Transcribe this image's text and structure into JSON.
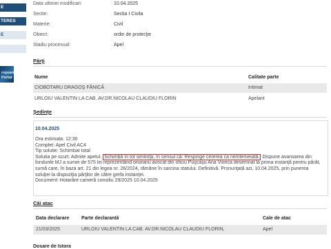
{
  "sidebar": {
    "items": [
      {
        "label": "E"
      },
      {
        "label": "TERES"
      },
      {
        "label": "E"
      },
      {
        "label": ""
      }
    ],
    "banner": {
      "line1": "ropean",
      "line2": "Portal"
    }
  },
  "case_info": [
    {
      "label": "Data ultimei modificari:",
      "value": "10.04.2025"
    },
    {
      "label": "Sectie:",
      "value": "Sectia I Civila"
    },
    {
      "label": "Materie:",
      "value": "Civil"
    },
    {
      "label": "Obiect:",
      "value": "ordin de protecţie"
    },
    {
      "label": "Stadiu procesual:",
      "value": "Apel"
    }
  ],
  "parti": {
    "title": "Părţi",
    "headers": {
      "name": "Nume",
      "role": "Calitate parte"
    },
    "rows": [
      {
        "name": "CIOBOTARU DRAGOŞ FĂNICĂ",
        "role": "Intimat"
      },
      {
        "name": "URLOIU VALENTIN LA CAB. AV.DR.NICOLAU CLAUDIU FLORIN",
        "role": "Apelant"
      }
    ]
  },
  "sedinte": {
    "title": "Şedinţe",
    "date": "10.04.2025",
    "ora": "Ora estimata: 12:30",
    "complet": "Complet: Apel Civil AC4",
    "tip": "Tip solutie: Schimbat total",
    "solutie_prefix": "Solutia pe scurt: Admite apelul.",
    "solutie_highlight": "Schimbă în tot sentinţa, în sensul că: Respinge cererea ca neîntemeiată.",
    "solutie_rest": "Dispune avansarea din fondurile MJ a sumei de 575 lei reprezentând onorariu avocat din oficiu Puşcaşu Ana Viorica desemnat la prima instanţă pentru pârât, sumă care, în baza art. 21 din legea nr. 26/2024, rămâne în sarcina statului. Definitivă. Pronunţată azi, 10.04.2025, prin punerea soluţiei la dispoziţia părţilor de către grefa instanţei.",
    "document": "Document: Hotarâre cameră consiliu  29/2025  10.04.2025"
  },
  "cai_atac": {
    "title": "Căi atac",
    "headers": {
      "date": "Data declarare",
      "party": "Parte declarantă",
      "type": "Cale de atac"
    },
    "rows": [
      {
        "date": "21/03/2025",
        "party": "URLOIU VALENTIN LA CAB. AV.DR.NICOLAU CLAUDIU FLORIN,",
        "type": "Apel"
      }
    ]
  },
  "trailing_title": "Dosare de Istora"
}
